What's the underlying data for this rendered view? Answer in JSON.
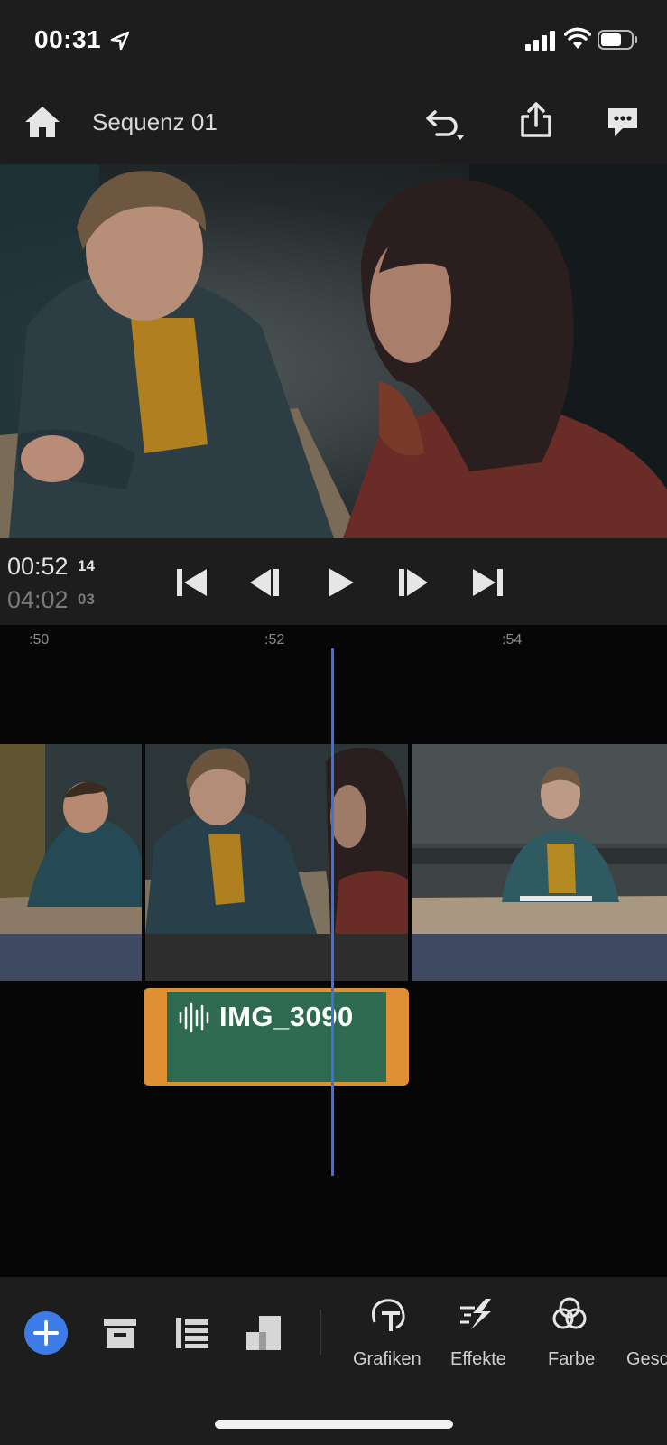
{
  "status_bar": {
    "time": "00:31"
  },
  "header": {
    "title": "Sequenz 01"
  },
  "timecode": {
    "current": "00:52",
    "current_frame": "14",
    "total": "04:02",
    "total_frame": "03"
  },
  "ruler": {
    "labels": [
      ":50",
      ":52",
      ":54"
    ]
  },
  "audio_clip": {
    "name": "IMG_3090"
  },
  "toolbar": {
    "tools": [
      {
        "label": "Grafiken",
        "icon": "graphics-text-icon"
      },
      {
        "label": "Effekte",
        "icon": "effects-icon"
      },
      {
        "label": "Farbe",
        "icon": "color-circles-icon"
      },
      {
        "label": "Gesc",
        "icon": "speed-icon"
      }
    ]
  },
  "colors": {
    "accent": "#3d7be6",
    "playhead": "#3f6fe0",
    "audio_clip_border": "#e08f32",
    "audio_clip_fill": "#2e6a4f",
    "video_track_bar": "#3f4a62"
  }
}
